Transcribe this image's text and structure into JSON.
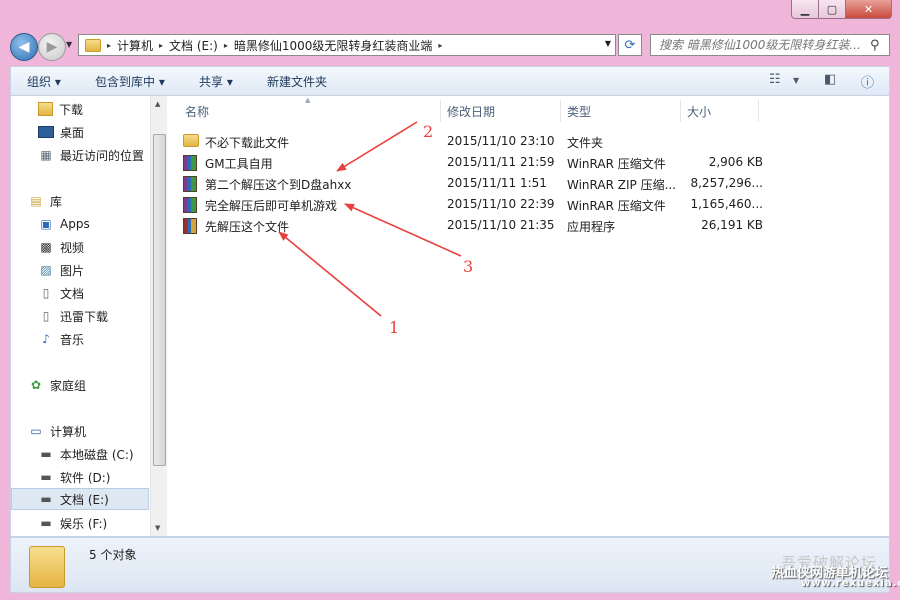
{
  "window": {
    "controls": {
      "minimize": "▁",
      "maximize": "▢",
      "close": "✕"
    }
  },
  "nav": {
    "back_icon": "◀",
    "forward_icon": "▶",
    "breadcrumb": [
      "计算机",
      "文档 (E:)",
      "暗黑修仙1000级无限转身红装商业端"
    ],
    "search_placeholder": "搜索 暗黑修仙1000级无限转身红装...",
    "refresh_icon": "⟳"
  },
  "toolbar": {
    "organize": "组织 ▾",
    "include_library": "包含到库中 ▾",
    "share": "共享 ▾",
    "new_folder": "新建文件夹"
  },
  "sidebar": {
    "favorites": [
      {
        "label": "下载",
        "icon": "download-folder-icon"
      },
      {
        "label": "桌面",
        "icon": "desktop-icon"
      },
      {
        "label": "最近访问的位置",
        "icon": "recent-places-icon"
      }
    ],
    "libraries_label": "库",
    "libraries": [
      {
        "label": "Apps",
        "icon": "apps-icon"
      },
      {
        "label": "视频",
        "icon": "video-icon"
      },
      {
        "label": "图片",
        "icon": "pictures-icon"
      },
      {
        "label": "文档",
        "icon": "documents-icon"
      },
      {
        "label": "迅雷下载",
        "icon": "thunder-download-icon"
      },
      {
        "label": "音乐",
        "icon": "music-icon"
      }
    ],
    "homegroup": "家庭组",
    "computer_label": "计算机",
    "drives": [
      {
        "label": "本地磁盘 (C:)",
        "selected": false
      },
      {
        "label": "软件 (D:)",
        "selected": false
      },
      {
        "label": "文档 (E:)",
        "selected": true
      },
      {
        "label": "娱乐 (F:)",
        "selected": false
      }
    ]
  },
  "columns": {
    "name": "名称",
    "date": "修改日期",
    "type": "类型",
    "size": "大小"
  },
  "files": [
    {
      "name": "不必下载此文件",
      "date": "2015/11/10 23:10",
      "type": "文件夹",
      "size": "",
      "icon": "folder-icon"
    },
    {
      "name": "GM工具自用",
      "date": "2015/11/11 21:59",
      "type": "WinRAR 压缩文件",
      "size": "2,906 KB",
      "icon": "winrar-icon"
    },
    {
      "name": "第二个解压这个到D盘ahxx",
      "date": "2015/11/11 1:51",
      "type": "WinRAR ZIP 压缩...",
      "size": "8,257,296...",
      "icon": "winrar-zip-icon"
    },
    {
      "name": "完全解压后即可单机游戏",
      "date": "2015/11/10 22:39",
      "type": "WinRAR 压缩文件",
      "size": "1,165,460...",
      "icon": "winrar-icon"
    },
    {
      "name": "先解压这个文件",
      "date": "2015/11/10 21:35",
      "type": "应用程序",
      "size": "26,191 KB",
      "icon": "exe-icon"
    }
  ],
  "annotations": [
    "1",
    "2",
    "3"
  ],
  "annotation_color": "#e8413c",
  "status": {
    "count": "5 个对象"
  },
  "watermark": {
    "line1": "吾爱破解论坛",
    "line2": "热血侠网游单机论坛",
    "line3": "www.rexuexia.com"
  }
}
